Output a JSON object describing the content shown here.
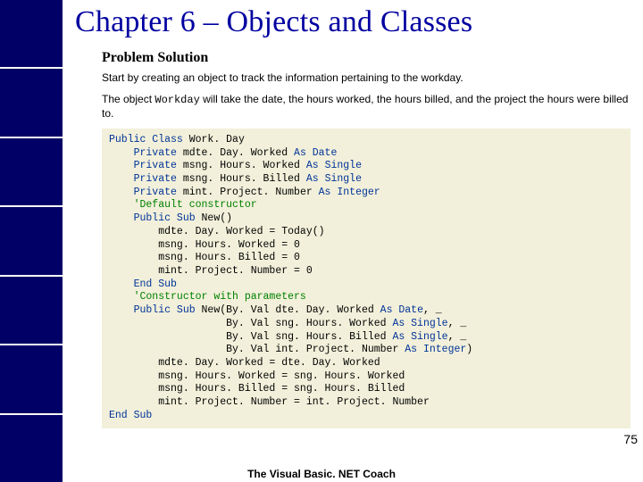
{
  "header": {
    "chapter_title": "Chapter 6 – Objects and Classes"
  },
  "section": {
    "title": "Problem Solution",
    "para1": "Start by creating an object to track the information pertaining to the workday.",
    "para2_a": "The object ",
    "para2_mono": "Workday",
    "para2_b": " will take the date, the hours worked, the hours billed, and the project the hours were billed to."
  },
  "code": {
    "l01a": "Public Class",
    "l01b": " Work. Day",
    "l02a": "    Private",
    "l02b": " mdte. Day. Worked ",
    "l02c": "As Date",
    "l03a": "    Private",
    "l03b": " msng. Hours. Worked ",
    "l03c": "As Single",
    "l04a": "    Private",
    "l04b": " msng. Hours. Billed ",
    "l04c": "As Single",
    "l05a": "    Private",
    "l05b": " mint. Project. Number ",
    "l05c": "As Integer",
    "l06": "    'Default constructor",
    "l07a": "    Public Sub",
    "l07b": " New()",
    "l08": "        mdte. Day. Worked = Today()",
    "l09": "        msng. Hours. Worked = 0",
    "l10": "        msng. Hours. Billed = 0",
    "l11": "        mint. Project. Number = 0",
    "l12a": "    End Sub",
    "l13": "    'Constructor with parameters",
    "l14a": "    Public Sub",
    "l14b": " New(By. Val dte. Day. Worked ",
    "l14c": "As Date",
    "l14d": ", _",
    "l15a": "                   By. Val sng. Hours. Worked ",
    "l15b": "As Single",
    "l15c": ", _",
    "l16a": "                   By. Val sng. Hours. Billed ",
    "l16b": "As Single",
    "l16c": ", _",
    "l17a": "                   By. Val int. Project. Number ",
    "l17b": "As Integer",
    "l17c": ")",
    "l18": "        mdte. Day. Worked = dte. Day. Worked",
    "l19": "        msng. Hours. Worked = sng. Hours. Worked",
    "l20": "        msng. Hours. Billed = sng. Hours. Billed",
    "l21": "        mint. Project. Number = int. Project. Number",
    "l22a": "End Sub"
  },
  "footer": {
    "book_title": "The Visual Basic. NET Coach",
    "page_number": "75"
  }
}
